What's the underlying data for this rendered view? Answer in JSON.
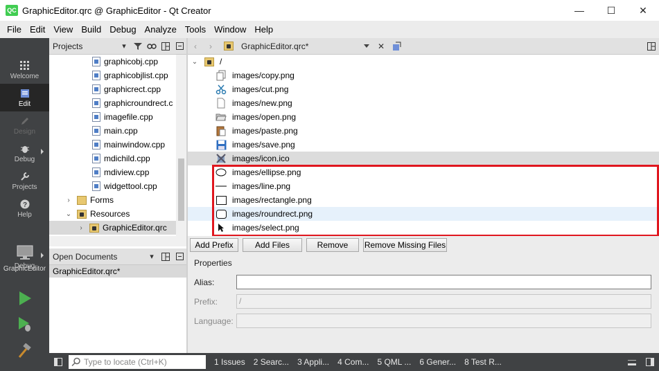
{
  "window": {
    "app_icon": "QC",
    "title": "GraphicEditor.qrc @ GraphicEditor - Qt Creator",
    "minimize": "—",
    "maximize": "☐",
    "close": "✕"
  },
  "menu": [
    "File",
    "Edit",
    "View",
    "Build",
    "Debug",
    "Analyze",
    "Tools",
    "Window",
    "Help"
  ],
  "modes": {
    "welcome": "Welcome",
    "edit": "Edit",
    "design": "Design",
    "debug": "Debug",
    "projects": "Projects",
    "help": "Help",
    "kit": "GraphicEditor",
    "kit_config": "Debug"
  },
  "projects_panel": {
    "title": "Projects",
    "files": [
      "graphicobj.cpp",
      "graphicobjlist.cpp",
      "graphicrect.cpp",
      "graphicroundrect.c",
      "imagefile.cpp",
      "main.cpp",
      "mainwindow.cpp",
      "mdichild.cpp",
      "mdiview.cpp",
      "widgettool.cpp"
    ],
    "forms": "Forms",
    "resources": "Resources",
    "qrc": "GraphicEditor.qrc"
  },
  "open_documents": {
    "title": "Open Documents",
    "items": [
      "GraphicEditor.qrc*"
    ]
  },
  "editor": {
    "doc_title": "GraphicEditor.qrc*",
    "root_prefix": "/",
    "resources": [
      "images/copy.png",
      "images/cut.png",
      "images/new.png",
      "images/open.png",
      "images/paste.png",
      "images/save.png",
      "images/icon.ico",
      "images/ellipse.png",
      "images/line.png",
      "images/rectangle.png",
      "images/roundrect.png",
      "images/select.png"
    ]
  },
  "buttons": {
    "add_prefix": "Add Prefix",
    "add_files": "Add Files",
    "remove": "Remove",
    "remove_missing": "Remove Missing Files"
  },
  "properties": {
    "title": "Properties",
    "alias_label": "Alias:",
    "alias_value": "",
    "prefix_label": "Prefix:",
    "prefix_value": "/",
    "language_label": "Language:",
    "language_value": ""
  },
  "statusbar": {
    "locator_placeholder": "Type to locate (Ctrl+K)",
    "panes": [
      "1  Issues",
      "2  Searc...",
      "3  Appli...",
      "4  Com...",
      "5  QML ...",
      "6  Gener...",
      "8  Test R..."
    ]
  },
  "colors": {
    "highlight_box": "#e0161e",
    "mode_bar": "#404244",
    "run_green": "#4caf50"
  }
}
